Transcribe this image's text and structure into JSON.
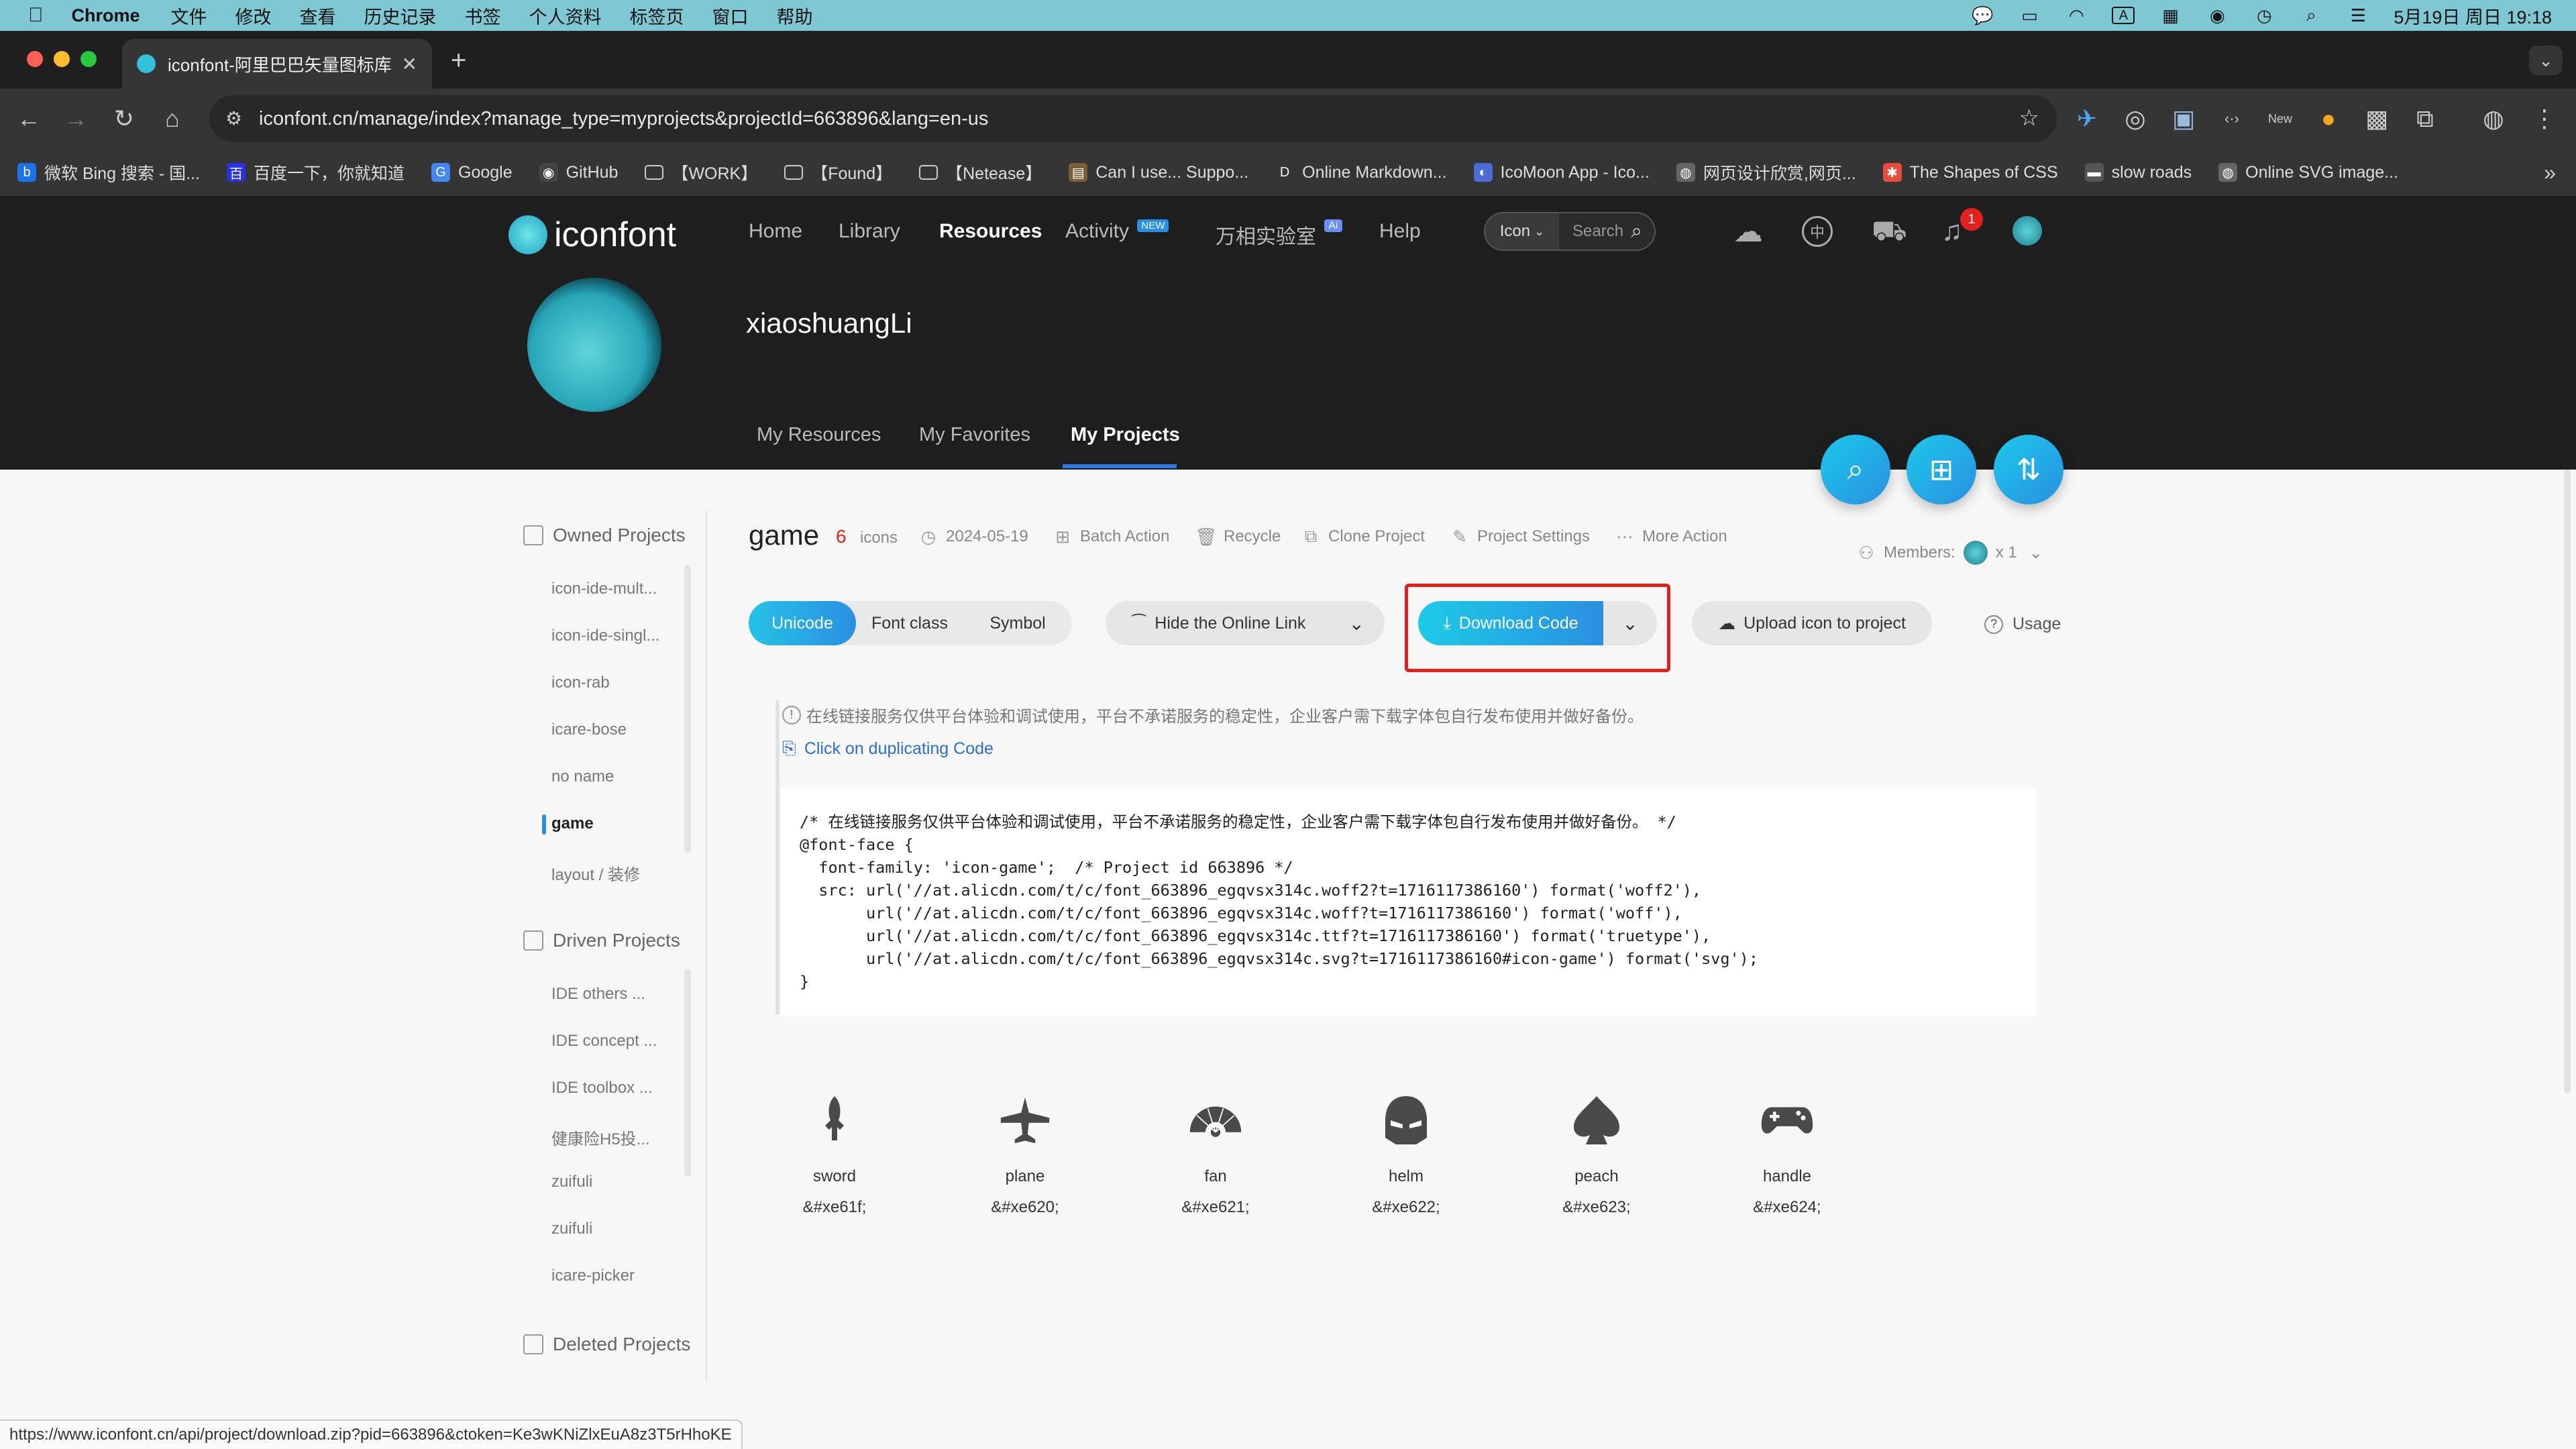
{
  "menubar": {
    "apple": "",
    "app": "Chrome",
    "items": [
      "文件",
      "修改",
      "查看",
      "历史记录",
      "书签",
      "个人资料",
      "标签页",
      "窗口",
      "帮助"
    ],
    "clock": "5月19日 周日 19:18"
  },
  "browser": {
    "tab_title": "iconfont-阿里巴巴矢量图标库",
    "url": "iconfont.cn/manage/index?manage_type=myprojects&projectId=663896&lang=en-us",
    "bookmarks": [
      {
        "label": "微软 Bing 搜索 - 国...",
        "icon": "bing-icon",
        "color": "#1a73e8"
      },
      {
        "label": "百度一下，你就知道",
        "icon": "baidu-icon",
        "color": "#2932e1"
      },
      {
        "label": "Google",
        "icon": "google-icon",
        "color": "#4285f4"
      },
      {
        "label": "GitHub",
        "icon": "github-icon",
        "color": "#444"
      },
      {
        "label": "【WORK】",
        "icon": "folder-icon",
        "color": "transparent"
      },
      {
        "label": "【Found】",
        "icon": "folder-icon",
        "color": "transparent"
      },
      {
        "label": "【Netease】",
        "icon": "folder-icon",
        "color": "transparent"
      },
      {
        "label": "Can I use... Suppo...",
        "icon": "caniuse-icon",
        "color": "#7a5e3a"
      },
      {
        "label": "Online Markdown...",
        "icon": "markdown-icon",
        "color": "transparent"
      },
      {
        "label": "IcoMoon App - Ico...",
        "icon": "icomoon-icon",
        "color": "#4b6cd6"
      },
      {
        "label": "网页设计欣赏,网页...",
        "icon": "globe-icon",
        "color": "#666"
      },
      {
        "label": "The Shapes of CSS",
        "icon": "css-tricks-icon",
        "color": "#e84c3d"
      },
      {
        "label": "slow roads",
        "icon": "road-icon",
        "color": "#555"
      },
      {
        "label": "Online SVG image...",
        "icon": "globe-icon",
        "color": "#666"
      }
    ],
    "status_url": "https://www.iconfont.cn/api/project/download.zip?pid=663896&ctoken=Ke3wKNiZlxEuA8z3T5rHhoKE"
  },
  "site": {
    "logo_text": "iconfont",
    "nav": [
      "Home",
      "Library",
      "Resources",
      "Activity",
      "万相实验室",
      "Help"
    ],
    "nav_active": "Resources",
    "activity_badge": "NEW",
    "lab_badge": "Ai",
    "search_type": "Icon",
    "search_placeholder": "Search",
    "notification_count": "1",
    "username": "xiaoshuangLi",
    "subnav": [
      "My Resources",
      "My Favorites",
      "My Projects"
    ],
    "subnav_active": "My Projects"
  },
  "sidebar": {
    "owned_title": "Owned Projects",
    "owned": [
      "icon-ide-mult...",
      "icon-ide-singl...",
      "icon-rab",
      "icare-bose",
      "no name",
      "game",
      "layout / 装修"
    ],
    "owned_active": "game",
    "driven_title": "Driven Projects",
    "driven": [
      "IDE others ...",
      "IDE concept ...",
      "IDE toolbox ...",
      "健康险H5投...",
      "zuifuli",
      "zuifuli",
      "icare-picker"
    ],
    "deleted_title": "Deleted Projects"
  },
  "project": {
    "name": "game",
    "icon_count": "6",
    "icons_label": "icons",
    "date": "2024-05-19",
    "actions": [
      "Batch Action",
      "Recycle",
      "Clone Project",
      "Project Settings",
      "More Action"
    ],
    "members_label": "Members:",
    "members_count": "x 1",
    "modes": [
      "Unicode",
      "Font class",
      "Symbol"
    ],
    "mode_active": "Unicode",
    "hide_link": "Hide the Online Link",
    "download": "Download Code",
    "upload": "Upload icon to project",
    "usage": "Usage",
    "notice": "在线链接服务仅供平台体验和调试使用，平台不承诺服务的稳定性，企业客户需下载字体包自行发布使用并做好备份。",
    "copy_link": "Click on duplicating Code",
    "code_lines": [
      "/* 在线链接服务仅供平台体验和调试使用，平台不承诺服务的稳定性，企业客户需下载字体包自行发布使用并做好备份。 */",
      "@font-face {",
      "  font-family: 'icon-game';  /* Project id 663896 */",
      "  src: url('//at.alicdn.com/t/c/font_663896_egqvsx314c.woff2?t=1716117386160') format('woff2'),",
      "       url('//at.alicdn.com/t/c/font_663896_egqvsx314c.woff?t=1716117386160') format('woff'),",
      "       url('//at.alicdn.com/t/c/font_663896_egqvsx314c.ttf?t=1716117386160') format('truetype'),",
      "       url('//at.alicdn.com/t/c/font_663896_egqvsx314c.svg?t=1716117386160#icon-game') format('svg');",
      "}"
    ],
    "glyphs": [
      {
        "name": "sword",
        "code": "&#xe61f;",
        "icon": "sword-icon"
      },
      {
        "name": "plane",
        "code": "&#xe620;",
        "icon": "plane-icon"
      },
      {
        "name": "fan",
        "code": "&#xe621;",
        "icon": "fan-icon"
      },
      {
        "name": "helm",
        "code": "&#xe622;",
        "icon": "helm-icon"
      },
      {
        "name": "peach",
        "code": "&#xe623;",
        "icon": "peach-icon"
      },
      {
        "name": "handle",
        "code": "&#xe624;",
        "icon": "gamepad-icon"
      }
    ]
  },
  "colors": {
    "accent": "#2a8fe2",
    "accent_cyan": "#1ccbe6",
    "highlight_outline": "#e3201b",
    "count_red": "#e3201b",
    "header_bg": "#1e1e1e"
  }
}
